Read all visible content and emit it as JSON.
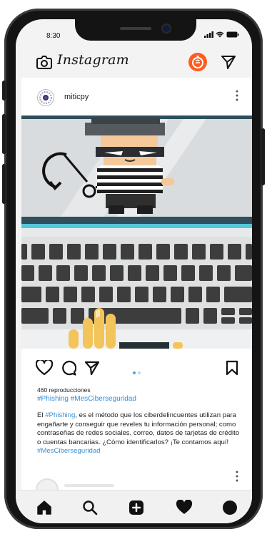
{
  "status_bar": {
    "time": "8:30"
  },
  "header": {
    "app_name": "Instagram"
  },
  "post": {
    "username": "miticpy",
    "views": "460 reproducciones",
    "hashtags": "#Phishing #MesCiberseguridad",
    "caption": {
      "prefix": "El ",
      "tag1": "#Phishing",
      "body": ", es el método que los ciberdelincuentes utilizan para engañarte y conseguir que reveles tu información personal; como contraseñas de redes sociales, correo, datos de tarjetas de crédito o cuentas bancarias. ¿Cómo identificarlos? ¡Te contamos aquí! ",
      "tag2": "#MesCiberseguridad"
    },
    "carousel": {
      "count": 2,
      "active_index": 0
    }
  },
  "colors": {
    "hashtag": "#3a8fd0",
    "dot_active": "#4da3d9",
    "dot_inactive": "#b9d9ee",
    "story_ring": "#ff5a1f"
  },
  "icons": {
    "camera": "camera-icon",
    "story": "story-button-icon",
    "direct": "paper-plane-icon",
    "like": "heart-outline-icon",
    "comment": "comment-icon",
    "share": "share-icon",
    "save": "bookmark-icon",
    "home": "home-icon",
    "search": "search-icon",
    "add": "add-post-icon",
    "activity": "heart-filled-icon",
    "profile": "profile-icon"
  }
}
